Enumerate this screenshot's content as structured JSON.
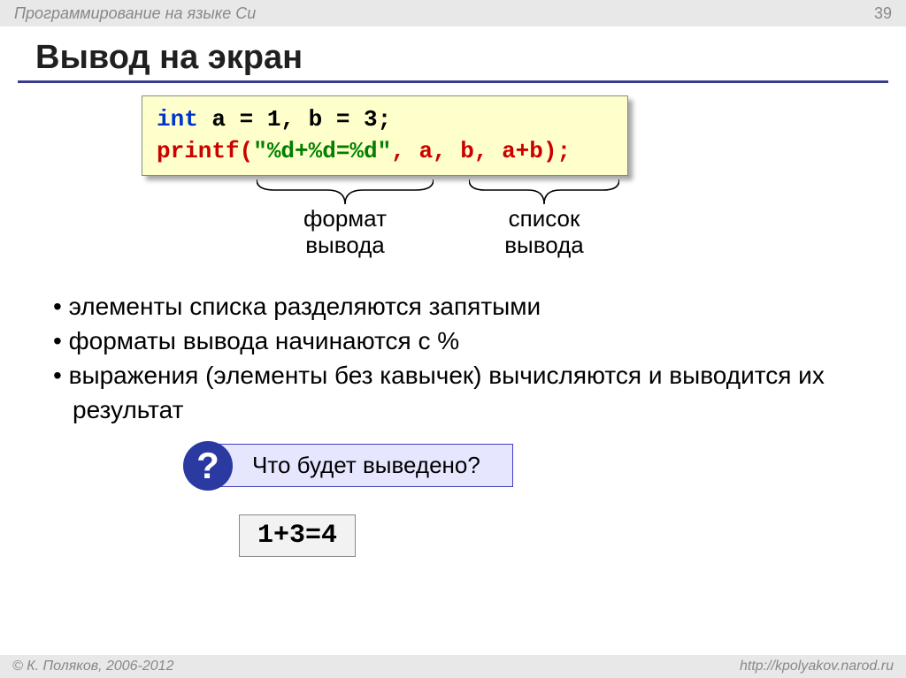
{
  "header": {
    "subject": "Программирование на языке Си",
    "page": "39"
  },
  "title": "Вывод на экран",
  "code": {
    "line1_int": "int",
    "line1_rest": " a = 1, b = 3;",
    "line2_printf": "printf(",
    "line2_fmt": "\"%d+%d=%d\"",
    "line2_args": ", a, b, a+b);"
  },
  "annotations": {
    "fmt_l1": "формат",
    "fmt_l2": "вывода",
    "list_l1": "список",
    "list_l2": "вывода"
  },
  "bullets": [
    "элементы списка разделяются запятыми",
    "форматы вывода начинаются с %",
    "выражения (элементы без кавычек) вычисляются и выводится их результат"
  ],
  "question": "Что будет выведено?",
  "question_mark": "?",
  "result": "1+3=4",
  "footer": {
    "copyright": "© К. Поляков, 2006-2012",
    "url": "http://kpolyakov.narod.ru"
  }
}
